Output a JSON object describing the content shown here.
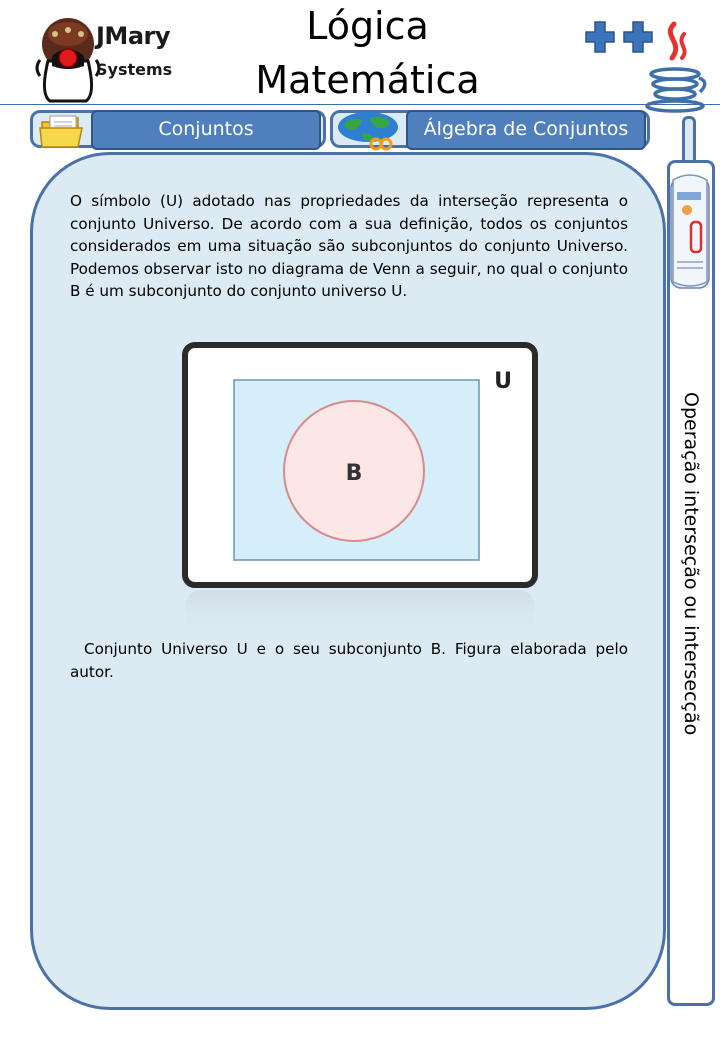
{
  "brand": {
    "line1": "JMary",
    "line2": "Systems"
  },
  "title": {
    "line1": "Lógica",
    "line2": "Matemática"
  },
  "nav": {
    "item1_label": "Conjuntos",
    "item2_label": "Álgebra de Conjuntos"
  },
  "sidebar": {
    "label": "Operação interseção ou intersecção"
  },
  "content": {
    "paragraph": "O símbolo (U) adotado nas propriedades da interseção representa o conjunto Universo. De acordo com a sua definição, todos os conjuntos considerados em uma situação são subconjuntos do conjunto Universo. Podemos observar isto no diagrama de Venn a seguir, no qual o conjunto B é um subconjunto do conjunto universo U.",
    "caption": "Conjunto Universo U e o seu subconjunto B. Figura elaborada pelo autor."
  },
  "figure": {
    "universe_label": "U",
    "subset_label": "B"
  },
  "icons": {
    "logo": "java-duke-logo",
    "plus": "plus-icon",
    "java": "java-cup-icon",
    "folder": "folder-icon",
    "globe": "globe-icon",
    "news": "newspaper-icon"
  },
  "colors": {
    "accent": "#4a72a8",
    "button": "#4f7fbd",
    "panel": "#dbeaf3",
    "plus": "#3d73b8"
  }
}
